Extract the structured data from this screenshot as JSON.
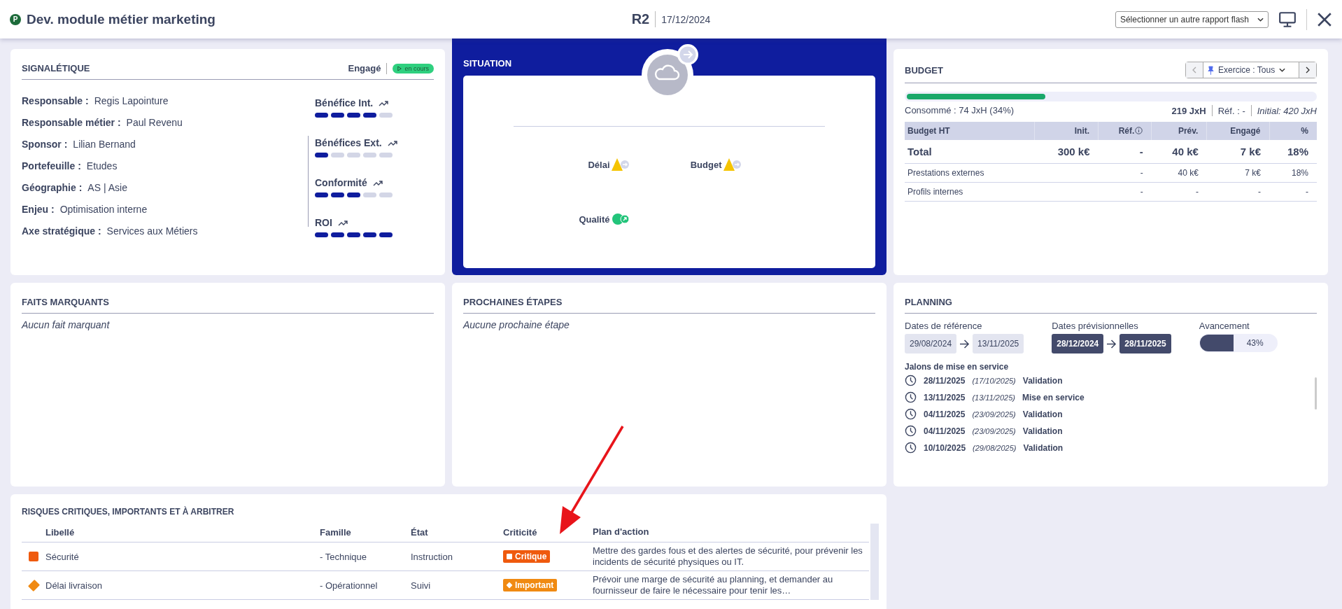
{
  "header": {
    "logo_letter": "P",
    "title": "Dev. module métier marketing",
    "report_code": "R2",
    "report_date": "17/12/2024",
    "report_select": "Sélectionner un autre rapport flash"
  },
  "signaletique": {
    "title": "SIGNALÉTIQUE",
    "status_label": "Engagé",
    "status_badge": "en cours",
    "fields": [
      {
        "label": "Responsable :",
        "value": "Regis Lapointure"
      },
      {
        "label": "Responsable métier :",
        "value": "Paul Revenu"
      },
      {
        "label": "Sponsor :",
        "value": "Lilian Bernand"
      },
      {
        "label": "Portefeuille :",
        "value": "Etudes"
      },
      {
        "label": "Géographie :",
        "value": "AS | Asie"
      },
      {
        "label": "Enjeu :",
        "value": "Optimisation interne"
      },
      {
        "label": "Axe stratégique :",
        "value": "Services aux Métiers"
      }
    ],
    "indicators": [
      {
        "name": "Bénéfice Int.",
        "stars": 4
      },
      {
        "name": "Bénéfices Ext.",
        "stars": 1
      },
      {
        "name": "Conformité",
        "stars": 3
      },
      {
        "name": "ROI",
        "stars": 5
      }
    ]
  },
  "situation": {
    "title": "SITUATION",
    "items": [
      {
        "label": "Délai",
        "kind": "warning"
      },
      {
        "label": "Budget",
        "kind": "warning"
      },
      {
        "label": "Qualité",
        "kind": "good"
      }
    ]
  },
  "budget": {
    "title": "BUDGET",
    "exercise": "Exercice : Tous",
    "level": 0.34,
    "consumed": "Consommé : 74 JxH (34%)",
    "total": "219 JxH",
    "ref": "Réf. : -",
    "initial": "Initial: 420 JxH",
    "columns": [
      "Budget HT",
      "Init.",
      "Réf.",
      "Prév.",
      "Engagé",
      "%"
    ],
    "rows": [
      {
        "kind": "total",
        "cells": [
          "Total",
          "300 k€",
          "-",
          "40 k€",
          "7 k€",
          "18%"
        ]
      },
      {
        "kind": "line",
        "cells": [
          "Prestations externes",
          "",
          "-",
          "40 k€",
          "7 k€",
          "18%"
        ]
      },
      {
        "kind": "line",
        "cells": [
          "Profils internes",
          "",
          "-",
          "-",
          "-",
          "-"
        ]
      }
    ]
  },
  "faits_marquants": {
    "title": "FAITS MARQUANTS",
    "empty": "Aucun fait marquant"
  },
  "prochaines_etapes": {
    "title": "PROCHAINES ÉTAPES",
    "empty": "Aucune prochaine étape"
  },
  "planning": {
    "title": "PLANNING",
    "reference": {
      "label": "Dates de référence",
      "start": "29/08/2024",
      "end": "13/11/2025"
    },
    "forecast": {
      "label": "Dates prévisionnelles",
      "start": "28/12/2024",
      "end": "28/11/2025"
    },
    "progress": {
      "label": "Avancement",
      "level": 0.43,
      "reading": "43%"
    },
    "milestones_title": "Jalons de mise en service",
    "milestones": [
      {
        "date": "28/11/2025",
        "ref_date": "(17/10/2025)",
        "label": "Validation"
      },
      {
        "date": "13/11/2025",
        "ref_date": "(13/11/2025)",
        "label": "Mise en service"
      },
      {
        "date": "04/11/2025",
        "ref_date": "(23/09/2025)",
        "label": "Validation"
      },
      {
        "date": "04/11/2025",
        "ref_date": "(23/09/2025)",
        "label": "Validation"
      },
      {
        "date": "10/10/2025",
        "ref_date": "(29/08/2025)",
        "label": "Validation"
      }
    ]
  },
  "risks": {
    "title": "RISQUES CRITIQUES, IMPORTANTS ET À ARBITRER",
    "columns": [
      "Libellé",
      "Famille",
      "État",
      "Criticité",
      "Plan d'action"
    ],
    "rows": [
      {
        "kind": "critique",
        "label": "Sécurité",
        "famille": "- Technique",
        "etat": "Instruction",
        "criticite": "Critique",
        "plan": "Mettre des gardes fous et des alertes de sécurité, pour prévenir les incidents de sécurité physiques ou IT."
      },
      {
        "kind": "important",
        "label": "Délai livraison",
        "famille": "- Opérationnel",
        "etat": "Suivi",
        "criticite": "Important",
        "plan": "Prévoir une marge de sécurité au planning, et demander au fournisseur de faire le nécessaire pour tenir les…"
      }
    ]
  }
}
